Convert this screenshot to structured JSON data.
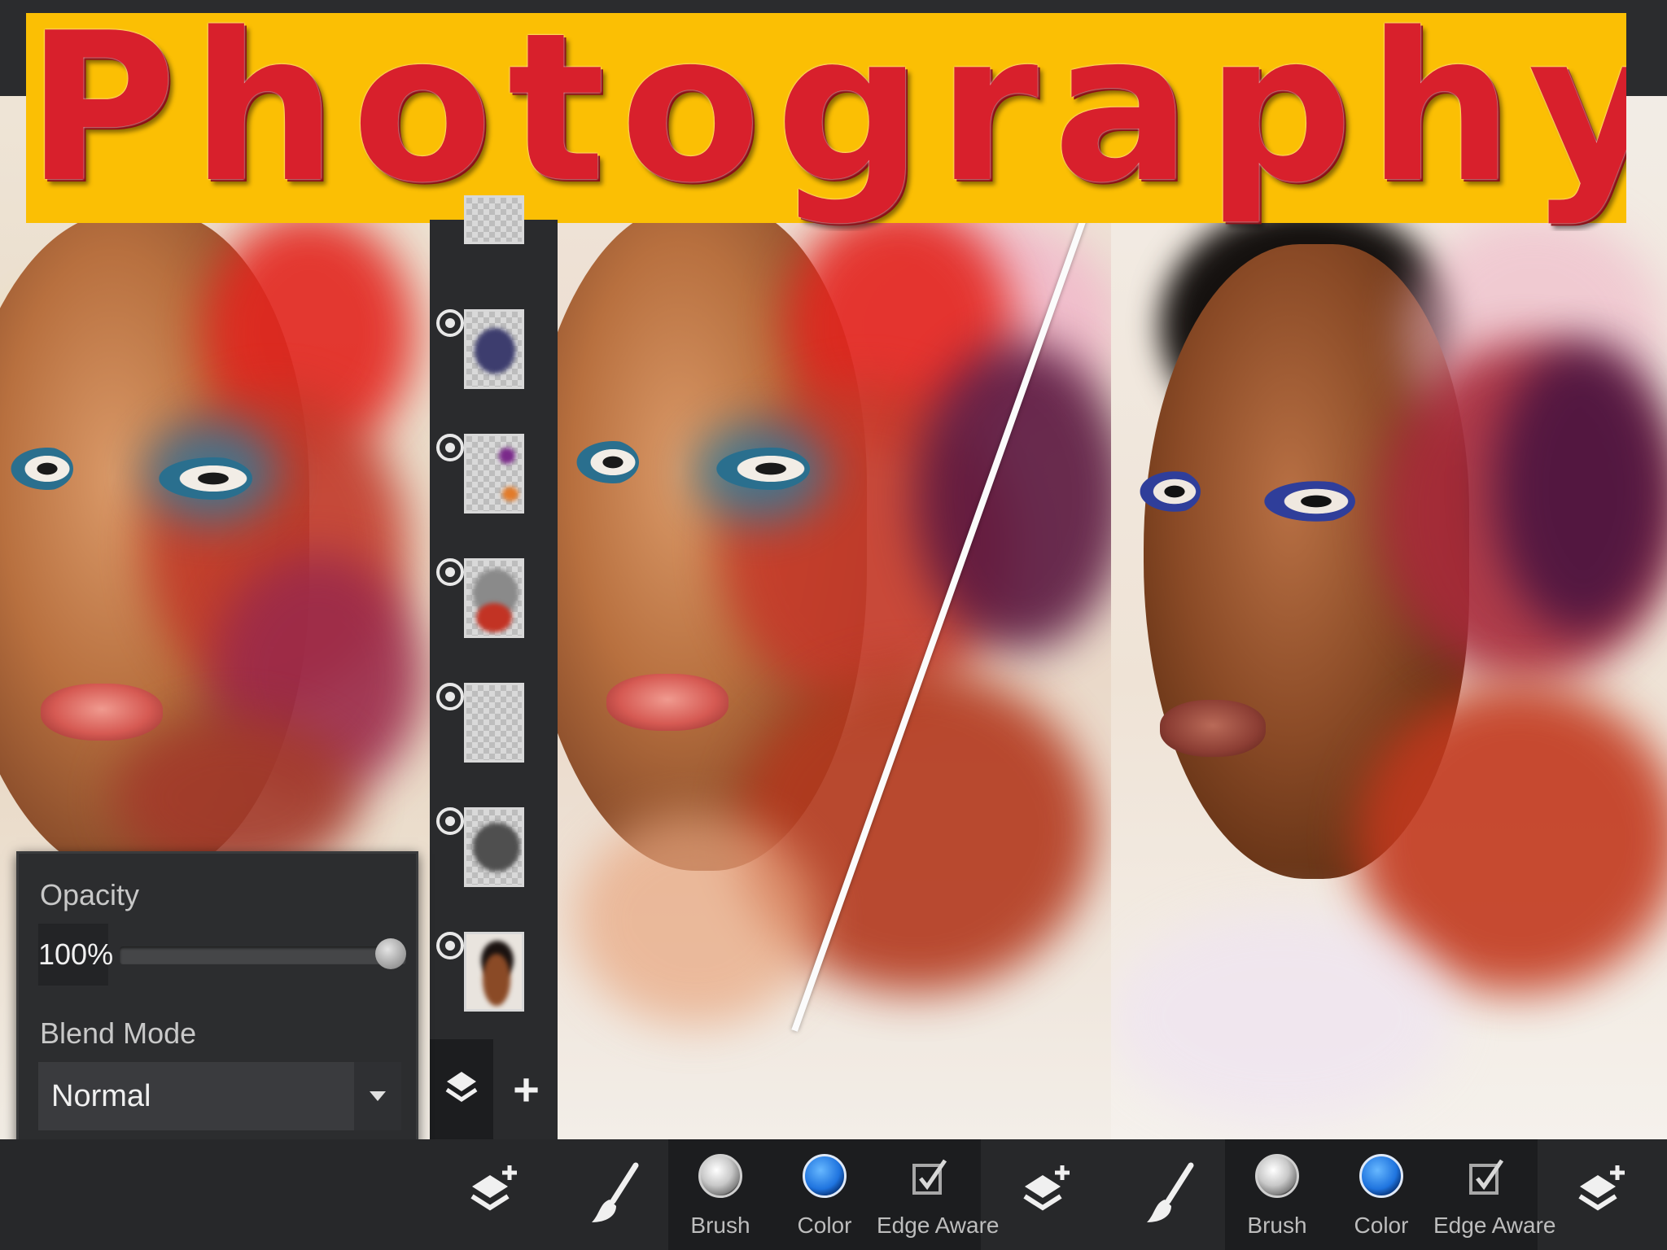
{
  "title": {
    "text": "Photography",
    "banner_color": "#fbbf04",
    "text_color": "#d8202c"
  },
  "layers": {
    "items": [
      {
        "icon": "layer-thumbnail"
      },
      {
        "icon": "layer-thumbnail"
      },
      {
        "icon": "layer-thumbnail"
      },
      {
        "icon": "layer-thumbnail"
      },
      {
        "icon": "layer-thumbnail"
      },
      {
        "icon": "layer-thumbnail"
      },
      {
        "icon": "layer-thumbnail"
      }
    ],
    "footer": {
      "layers_icon": "layers-icon",
      "add_label": "+"
    }
  },
  "layer_props": {
    "opacity_label": "Opacity",
    "opacity_value": "100%",
    "opacity_fraction": 1.0,
    "blend_label": "Blend Mode",
    "blend_value": "Normal",
    "merge_icon": "merge-down-icon",
    "delete_icon": "trash-icon"
  },
  "toolbars": [
    {
      "brush_label": "Brush",
      "color_label": "Color",
      "edge_label": "Edge Aware",
      "accent_color": "#1f74df"
    },
    {
      "brush_label": "Brush",
      "color_label": "Color",
      "edge_label": "Edge Aware",
      "accent_color": "#1f74df"
    }
  ]
}
